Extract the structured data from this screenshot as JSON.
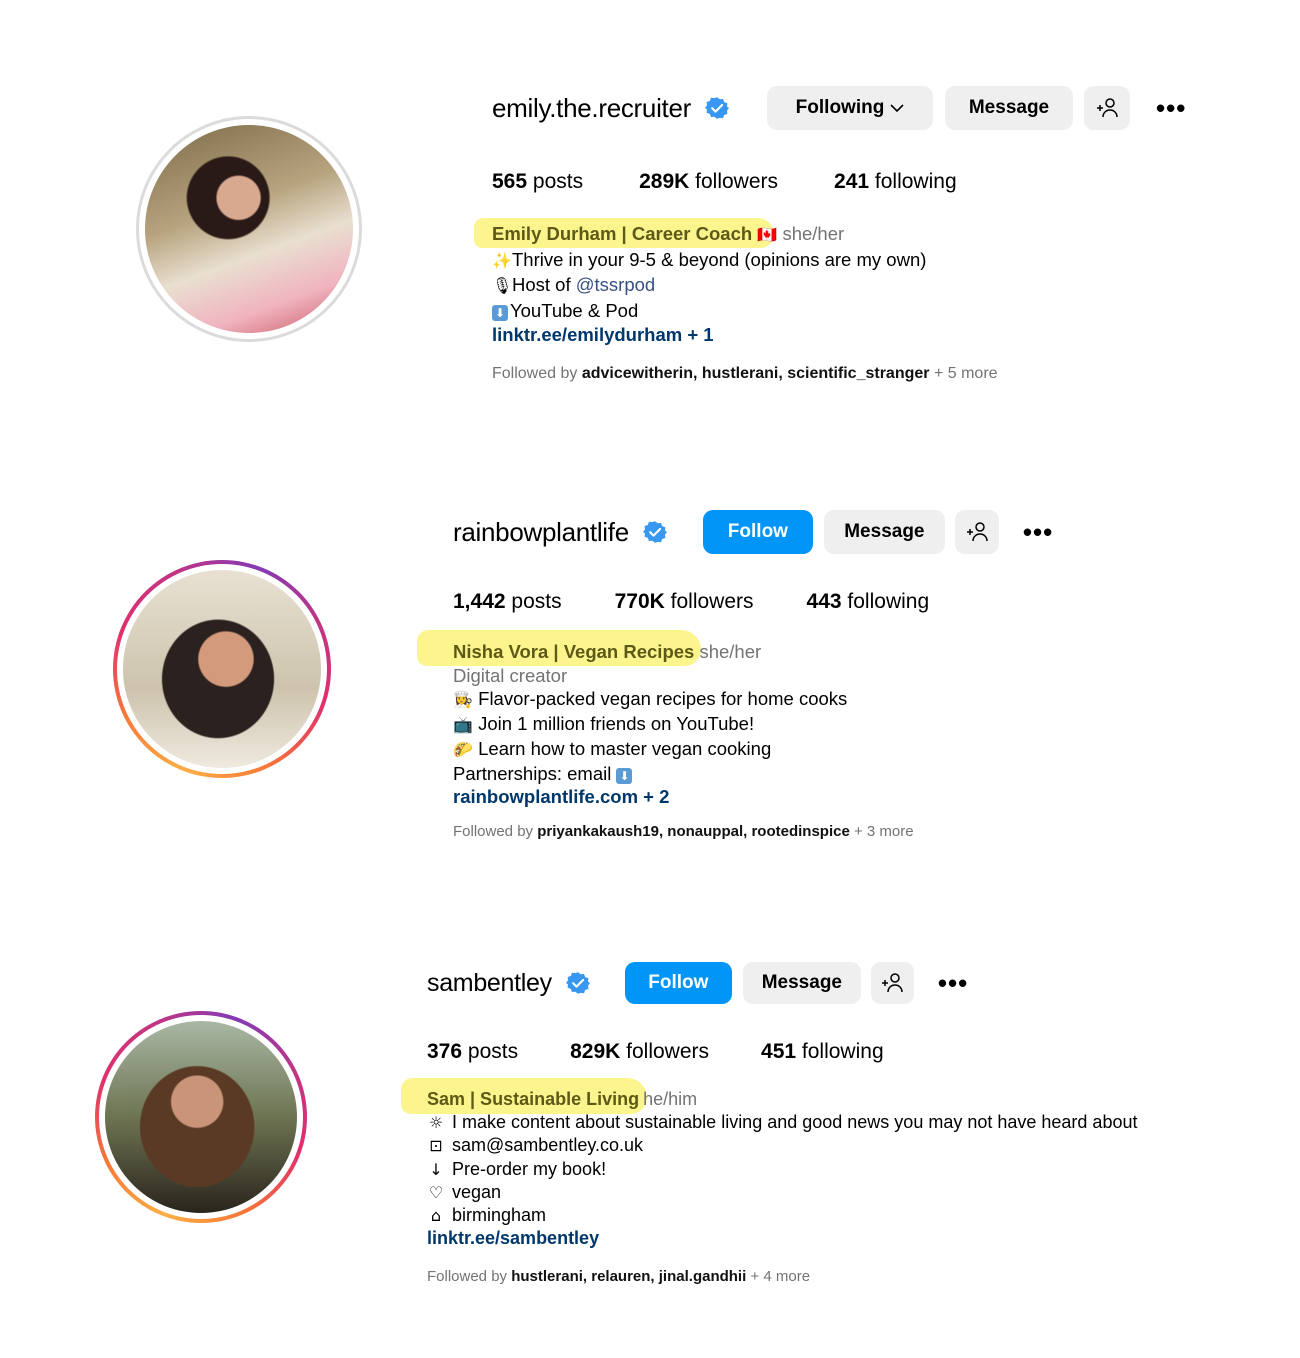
{
  "profiles": [
    {
      "username": "emily.the.recruiter",
      "verified": true,
      "avatar_ring": "none",
      "buttons": {
        "primary_label": "Following",
        "primary_has_chevron": true,
        "message_label": "Message",
        "suggest_icon": "add-person-icon",
        "more_icon": "more-options-icon"
      },
      "stats": {
        "posts_count": "565",
        "posts_label": "posts",
        "followers_count": "289K",
        "followers_label": "followers",
        "following_count": "241",
        "following_label": "following"
      },
      "bio": {
        "name": "Emily Durham | Career Coach",
        "name_emoji": "🇨🇦",
        "pronouns": "she/her",
        "lines": [
          {
            "emoji": "✨",
            "text": "Thrive in your 9-5 & beyond (opinions are my own)"
          },
          {
            "emoji": "🎙",
            "text_before": "Host of ",
            "mention": "@tssrpod"
          },
          {
            "emoji": "⬇",
            "text": "YouTube & Pod"
          }
        ],
        "link": "linktr.ee/emilydurham + 1"
      },
      "followed_by": {
        "prefix": "Followed by",
        "names": "advicewitherin, hustlerani, scientific_stranger",
        "suffix": "+ 5 more"
      }
    },
    {
      "username": "rainbowplantlife",
      "verified": true,
      "avatar_ring": "story",
      "buttons": {
        "primary_label": "Follow",
        "message_label": "Message",
        "suggest_icon": "add-person-icon",
        "more_icon": "more-options-icon"
      },
      "stats": {
        "posts_count": "1,442",
        "posts_label": "posts",
        "followers_count": "770K",
        "followers_label": "followers",
        "following_count": "443",
        "following_label": "following"
      },
      "bio": {
        "name": "Nisha Vora | Vegan Recipes",
        "pronouns": "she/her",
        "category": "Digital creator",
        "lines": [
          {
            "emoji": "👩‍🍳",
            "text": "Flavor-packed vegan recipes for home cooks"
          },
          {
            "emoji": "📺",
            "text": "Join 1 million friends on YouTube!"
          },
          {
            "emoji": "🌮",
            "text": "Learn how to master vegan cooking"
          },
          {
            "text": "Partnerships: email",
            "emoji_after": "⬇"
          }
        ],
        "link": "rainbowplantlife.com + 2"
      },
      "followed_by": {
        "prefix": "Followed by",
        "names": "priyankakaush19, nonauppal, rootedinspice",
        "suffix": "+ 3 more"
      }
    },
    {
      "username": "sambentley",
      "verified": true,
      "avatar_ring": "story",
      "buttons": {
        "primary_label": "Follow",
        "message_label": "Message",
        "suggest_icon": "add-person-icon",
        "more_icon": "more-options-icon"
      },
      "stats": {
        "posts_count": "376",
        "posts_label": "posts",
        "followers_count": "829K",
        "followers_label": "followers",
        "following_count": "451",
        "following_label": "following"
      },
      "bio": {
        "name": "Sam | Sustainable Living",
        "pronouns": "he/him",
        "lines": [
          {
            "emoji": "☼",
            "text": "I make content about sustainable living and good news you may not have heard about"
          },
          {
            "emoji": "⊡",
            "text": "sam@sambentley.co.uk"
          },
          {
            "emoji": "↓",
            "text": "Pre-order my book!"
          },
          {
            "emoji": "♡",
            "text": "vegan"
          },
          {
            "emoji": "⌂",
            "text": "birmingham"
          }
        ],
        "link": "linktr.ee/sambentley"
      },
      "followed_by": {
        "prefix": "Followed by",
        "names": "hustlerani, relauren, jinal.gandhii",
        "suffix": "+ 4 more"
      }
    }
  ],
  "colors": {
    "follow_blue": "#0095f6",
    "button_gray": "#efefef",
    "verified_blue": "#3897f0",
    "link_navy": "#00376b",
    "mention_blue": "#385185",
    "secondary_text": "#737373",
    "highlight_yellow": "#fbf37a"
  }
}
